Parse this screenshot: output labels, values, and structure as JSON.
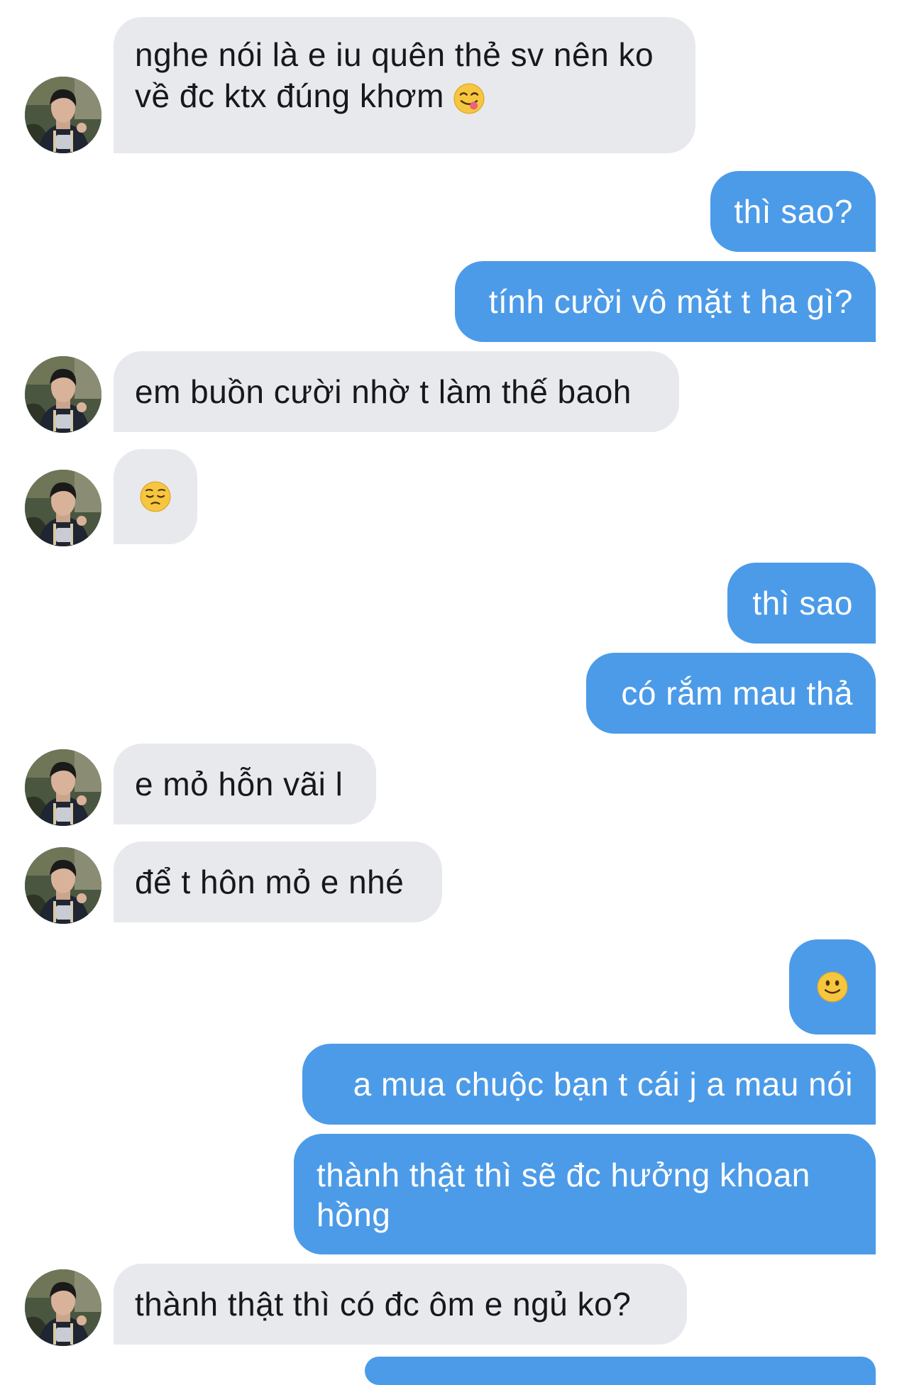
{
  "conversation": {
    "messages": [
      {
        "sender": "them",
        "text": "nghe nói là e iu quên thẻ sv nên ko về đc ktx đúng khơm",
        "emoji": "yum-face"
      },
      {
        "sender": "me",
        "text": "thì sao?"
      },
      {
        "sender": "me",
        "text": "tính cười vô mặt t ha gì?"
      },
      {
        "sender": "them",
        "text": "em buồn cười nhờ t làm thế baoh"
      },
      {
        "sender": "them",
        "text": "",
        "emoji": "pensive-face"
      },
      {
        "sender": "me",
        "text": "thì sao"
      },
      {
        "sender": "me",
        "text": "có rắm mau thả"
      },
      {
        "sender": "them",
        "text": "e mỏ hỗn vãi l"
      },
      {
        "sender": "them",
        "text": "để t hôn mỏ e nhé"
      },
      {
        "sender": "me",
        "text": "",
        "emoji": "slightly-smiling-face"
      },
      {
        "sender": "me",
        "text": "a mua chuộc bạn t cái j a mau nói"
      },
      {
        "sender": "me",
        "text": "thành thật thì sẽ đc hưởng khoan hồng"
      },
      {
        "sender": "them",
        "text": "thành thật thì có đc ôm e ngủ ko?"
      }
    ]
  },
  "colors": {
    "incoming_bubble": "#e8e9ec",
    "outgoing_bubble": "#4c9be8",
    "incoming_text": "#16181c",
    "outgoing_text": "#ffffff"
  }
}
